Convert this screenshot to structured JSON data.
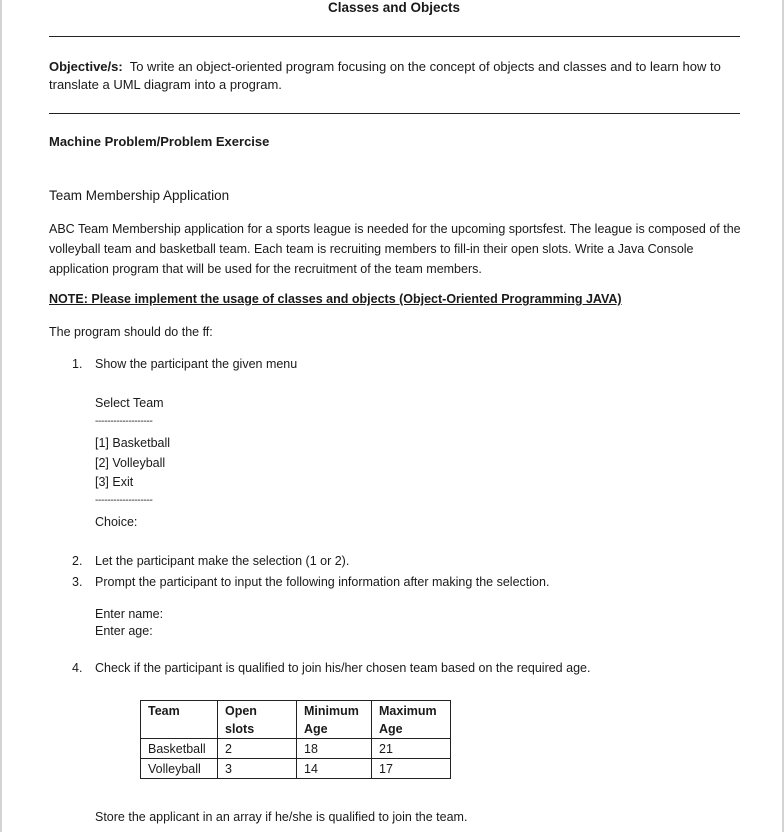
{
  "document": {
    "title": "Classes and Objects",
    "objective_label": "Objective/s:",
    "objective_text": "To write an object-oriented program focusing on the concept of objects and classes and to learn how to translate a UML diagram into a program.",
    "section_heading": "Machine Problem/Problem Exercise",
    "subheading": "Team Membership Application",
    "description": "ABC Team Membership application for a sports league is needed for the upcoming sportsfest. The league is composed of the volleyball team and basketball team. Each team is recruiting members to fill-in their open slots. Write a Java Console application program that will be used for the recruitment of the team members.",
    "note": "NOTE: Please implement the usage of classes and objects (Object-Oriented Programming JAVA)",
    "lead": "The program should do the ff:",
    "steps": [
      {
        "num": "1.",
        "text": "Show the participant the given menu"
      },
      {
        "num": "2.",
        "text": "Let the participant make the selection (1 or 2)."
      },
      {
        "num": "3.",
        "text": "Prompt the participant to input the following information after making the selection."
      },
      {
        "num": "4.",
        "text": "Check if the participant is qualified to join his/her chosen team based on the required age."
      }
    ],
    "menu": {
      "title": "Select Team",
      "divider": "-------------------",
      "options": [
        "[1] Basketball",
        "[2] Volleyball",
        "[3] Exit"
      ],
      "prompt": "Choice:"
    },
    "inputs": [
      "Enter name:",
      "Enter age:"
    ],
    "table": {
      "headers": [
        [
          "Team"
        ],
        [
          "Open",
          "slots"
        ],
        [
          "Minimum",
          "Age"
        ],
        [
          "Maximum",
          "Age"
        ]
      ],
      "rows": [
        [
          "Basketball",
          "2",
          "18",
          "21"
        ],
        [
          "Volleyball",
          "3",
          "14",
          "17"
        ]
      ]
    },
    "footer_text": "Store the applicant in an array if he/she is qualified to join the team."
  }
}
